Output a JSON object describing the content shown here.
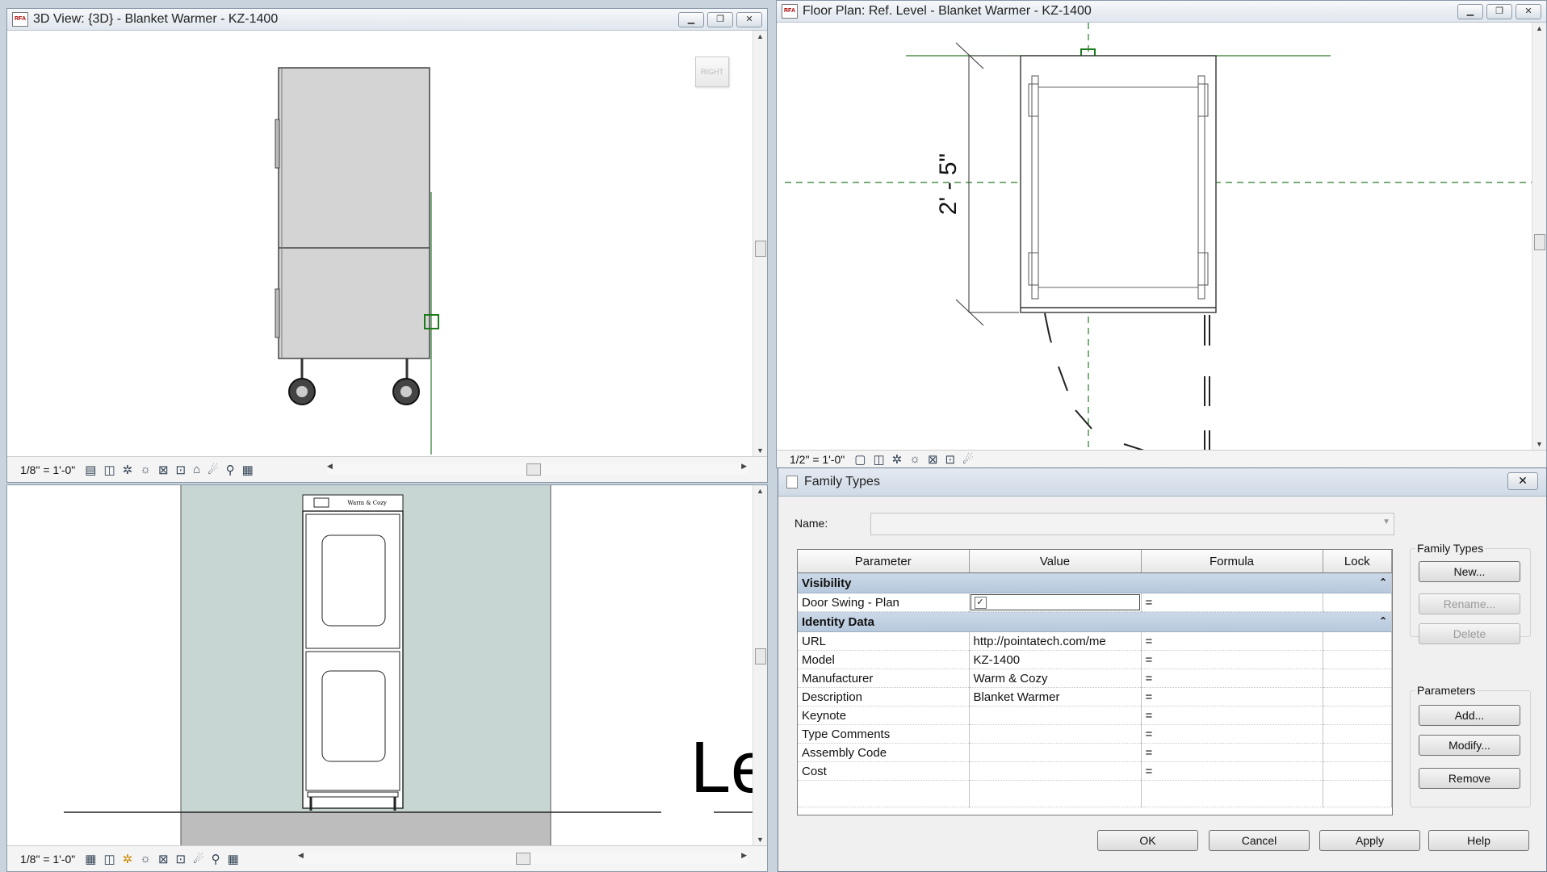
{
  "windows": {
    "view3d": {
      "title": "3D View: {3D} - Blanket Warmer - KZ-1400",
      "scale": "1/8\" = 1'-0\"",
      "viewcube": "RIGHT"
    },
    "floorplan": {
      "title": "Floor Plan: Ref. Level - Blanket Warmer - KZ-1400",
      "scale": "1/2\" = 1'-0\"",
      "dimension": "2' - 5\""
    },
    "elevation": {
      "scale": "1/8\" = 1'-0\"",
      "level_text": "Le",
      "brand_text": "Warm & Cozy"
    }
  },
  "dialog": {
    "title": "Family Types",
    "close": "✕",
    "name_label": "Name:",
    "name_value": "",
    "columns": [
      "Parameter",
      "Value",
      "Formula",
      "Lock"
    ],
    "groups": {
      "visibility": {
        "label": "Visibility"
      },
      "identity": {
        "label": "Identity Data"
      }
    },
    "rows": {
      "door_swing": {
        "param": "Door Swing - Plan",
        "value": "✓",
        "formula": "="
      },
      "url": {
        "param": "URL",
        "value": "http://pointatech.com/me",
        "formula": "="
      },
      "model": {
        "param": "Model",
        "value": "KZ-1400",
        "formula": "="
      },
      "manufacturer": {
        "param": "Manufacturer",
        "value": "Warm & Cozy",
        "formula": "="
      },
      "description": {
        "param": "Description",
        "value": "Blanket Warmer",
        "formula": "="
      },
      "keynote": {
        "param": "Keynote",
        "value": "",
        "formula": "="
      },
      "type_comments": {
        "param": "Type Comments",
        "value": "",
        "formula": "="
      },
      "assembly_code": {
        "param": "Assembly Code",
        "value": "",
        "formula": "="
      },
      "cost": {
        "param": "Cost",
        "value": "",
        "formula": "="
      }
    },
    "family_types": {
      "caption": "Family Types",
      "new": "New...",
      "rename": "Rename...",
      "delete": "Delete"
    },
    "parameters": {
      "caption": "Parameters",
      "add": "Add...",
      "modify": "Modify...",
      "remove": "Remove"
    },
    "footer": {
      "ok": "OK",
      "cancel": "Cancel",
      "apply": "Apply",
      "help": "Help"
    }
  },
  "icons": [
    "window-icon",
    "minimize-icon",
    "restore-icon",
    "close-icon",
    "chevron-up-icon",
    "checkbox-icon"
  ]
}
